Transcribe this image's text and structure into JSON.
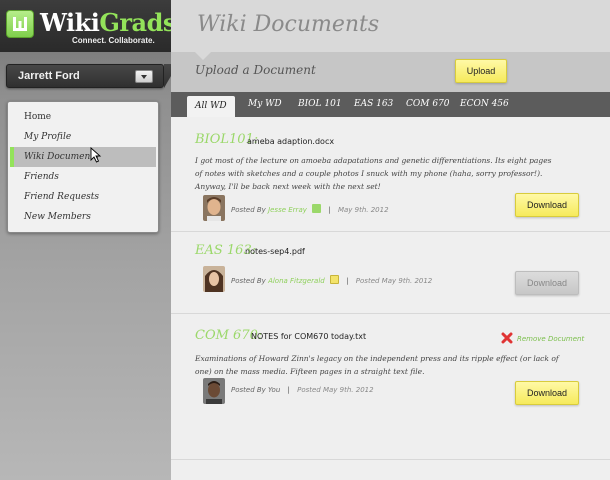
{
  "app": {
    "brand_part1": "Wiki",
    "brand_part2": "Grads",
    "tagline": "Connect. Collaborate.",
    "brand_color": "#93e35a"
  },
  "user": {
    "name": "Jarrett Ford",
    "dropdown_icon": "chevron-down-icon"
  },
  "nav": {
    "items": [
      {
        "label": "Home",
        "active": false
      },
      {
        "label": "My Profile",
        "active": false
      },
      {
        "label": "Wiki Documents",
        "active": true
      },
      {
        "label": "Friends",
        "active": false
      },
      {
        "label": "Friend Requests",
        "active": false
      },
      {
        "label": "New Members",
        "active": false
      }
    ]
  },
  "page": {
    "title": "Wiki Documents",
    "upload_label": "Upload a Document",
    "upload_button": "Upload"
  },
  "tabs": [
    {
      "label": "All WD",
      "active": true
    },
    {
      "label": "My WD",
      "active": false
    },
    {
      "label": "BIOL 101",
      "active": false
    },
    {
      "label": "EAS 163",
      "active": false
    },
    {
      "label": "COM 670",
      "active": false
    },
    {
      "label": "ECON 456",
      "active": false
    }
  ],
  "documents": [
    {
      "course": "BIOL101:",
      "file": "ameba adaption.docx",
      "description": "I got most of the lecture on amoeba adapatations and genetic differentiations.  Its eight pages of notes with sketches and a couple photos I snuck with my phone (haha, sorry professor!).  Anyway, I'll be back next week with the next set!",
      "posted_by_label": "Posted By",
      "author": "Jesse Erray",
      "separator": "|",
      "date": "May 9th. 2012",
      "download_label": "Download",
      "download_enabled": true
    },
    {
      "course": "EAS 163:",
      "file": "notes-sep4.pdf",
      "description": "",
      "posted_by_label": "Posted By",
      "author": "Alona Fitzgerald",
      "separator": "|",
      "date": "Posted May 9th. 2012",
      "download_label": "Download",
      "download_enabled": false
    },
    {
      "course": "COM 670:",
      "file": "NOTES for COM670 today.txt",
      "description": "Examinations of Howard Zinn's legacy on the independent press and its ripple effect (or lack of one) on the mass media.  Fifteen pages in a straight text file.",
      "posted_by_label": "Posted By You",
      "author": "",
      "separator": "|",
      "date": "Posted May 9th. 2012",
      "download_label": "Download",
      "download_enabled": true,
      "remove_label": "Remove Document"
    }
  ]
}
